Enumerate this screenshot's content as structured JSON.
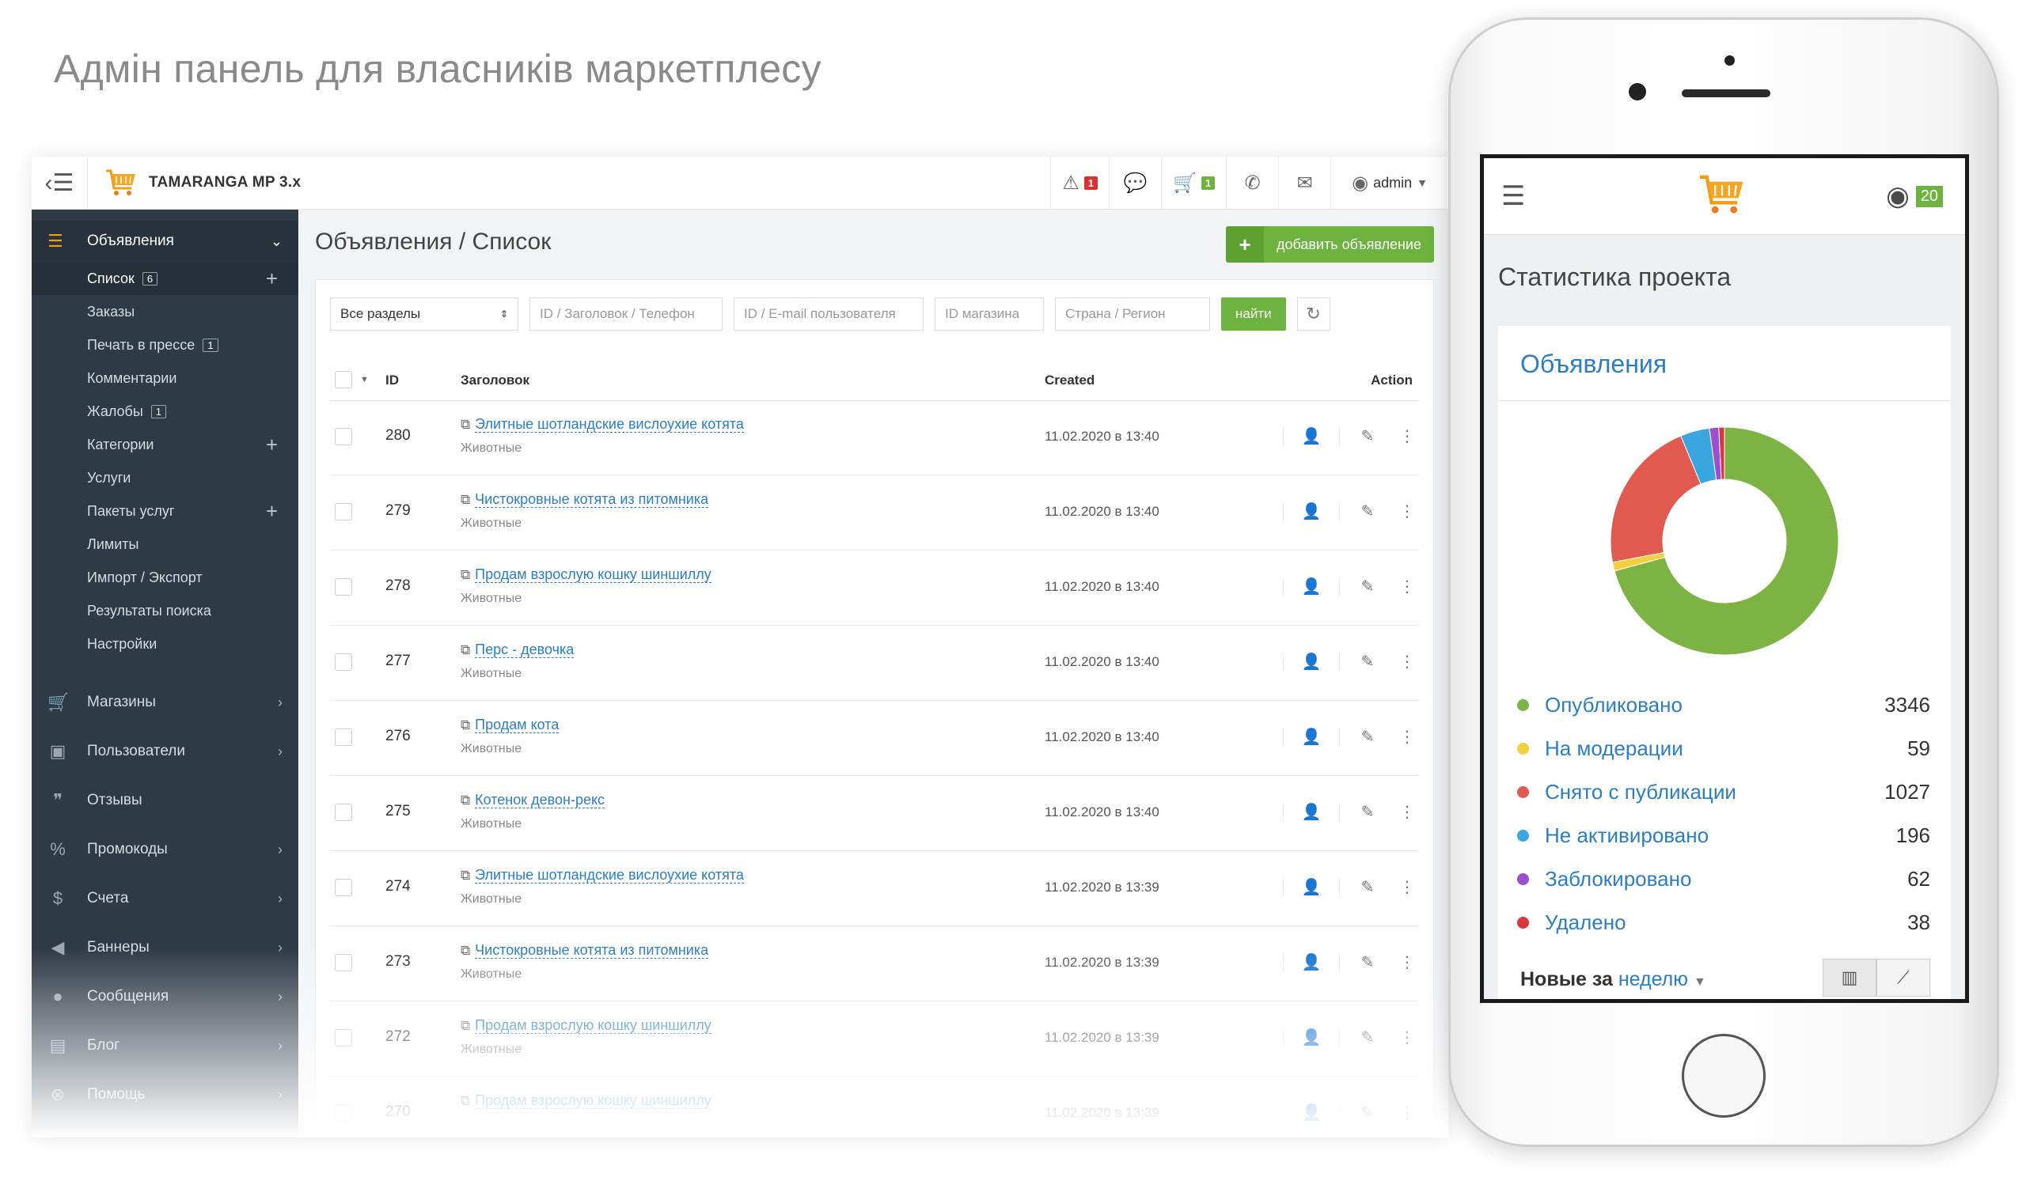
{
  "hero_title": "Адмін панель для власників маркетплесу",
  "colors": {
    "accent_green": "#6cb33f",
    "sidebar_bg": "#2e3a46",
    "link_blue": "#2a7ec1",
    "badge_red": "#d9312b"
  },
  "topbar": {
    "brand": "TAMARANGA MP 3.x",
    "alerts_count": "1",
    "cart_count": "1",
    "user": "admin",
    "icons": [
      "menu-icon",
      "warning-icon",
      "chat-icon",
      "cart-icon",
      "phone-icon",
      "envelope-icon",
      "user-icon"
    ]
  },
  "sidebar": {
    "section": "Объявления",
    "sub": [
      {
        "label": "Список",
        "count": "6",
        "plus": true,
        "active": true
      },
      {
        "label": "Заказы"
      },
      {
        "label": "Печать в прессе",
        "count": "1"
      },
      {
        "label": "Комментарии"
      },
      {
        "label": "Жалобы",
        "count": "1"
      },
      {
        "label": "Категории",
        "plus": true
      },
      {
        "label": "Услуги"
      },
      {
        "label": "Пакеты услуг",
        "plus": true
      },
      {
        "label": "Лимиты"
      },
      {
        "label": "Импорт / Экспорт"
      },
      {
        "label": "Результаты поиска"
      },
      {
        "label": "Настройки"
      }
    ],
    "main": [
      {
        "label": "Магазины",
        "icon": "cart-icon",
        "glyph": "🛒",
        "chev": true
      },
      {
        "label": "Пользователи",
        "icon": "id-card-icon",
        "glyph": "▣",
        "chev": true
      },
      {
        "label": "Отзывы",
        "icon": "quote-icon",
        "glyph": "❞",
        "chev": false
      },
      {
        "label": "Промокоды",
        "icon": "percent-icon",
        "glyph": "%",
        "chev": true
      },
      {
        "label": "Счета",
        "icon": "money-icon",
        "glyph": "$",
        "chev": true
      },
      {
        "label": "Баннеры",
        "icon": "megaphone-icon",
        "glyph": "◀",
        "chev": true
      },
      {
        "label": "Сообщения",
        "icon": "chat-icon",
        "glyph": "●",
        "chev": true
      },
      {
        "label": "Блог",
        "icon": "blog-icon",
        "glyph": "▤",
        "chev": true
      },
      {
        "label": "Помощь",
        "icon": "help-icon",
        "glyph": "⊗",
        "chev": true
      }
    ]
  },
  "content": {
    "title": "Объявления / Список",
    "add_button": "добавить объявление",
    "filters": {
      "section_select": "Все разделы",
      "title_placeholder": "ID / Заголовок / Телефон",
      "user_placeholder": "ID / E-mail пользователя",
      "shop_placeholder": "ID магазина",
      "region_placeholder": "Страна / Регион",
      "find_button": "найти"
    },
    "columns": {
      "id": "ID",
      "title": "Заголовок",
      "created": "Created",
      "action": "Action"
    },
    "rows": [
      {
        "id": "280",
        "title": "Элитные шотландские вислоухие котята",
        "category": "Животные",
        "created": "11.02.2020 в 13:40"
      },
      {
        "id": "279",
        "title": "Чистокровные котята из питомника",
        "category": "Животные",
        "created": "11.02.2020 в 13:40"
      },
      {
        "id": "278",
        "title": "Продам взрослую кошку шиншиллу",
        "category": "Животные",
        "created": "11.02.2020 в 13:40"
      },
      {
        "id": "277",
        "title": "Перс - девочка",
        "category": "Животные",
        "created": "11.02.2020 в 13:40"
      },
      {
        "id": "276",
        "title": "Продам кота",
        "category": "Животные",
        "created": "11.02.2020 в 13:40"
      },
      {
        "id": "275",
        "title": "Котенок девон-рекс",
        "category": "Животные",
        "created": "11.02.2020 в 13:40"
      },
      {
        "id": "274",
        "title": "Элитные шотландские вислоухие котята",
        "category": "Животные",
        "created": "11.02.2020 в 13:39"
      },
      {
        "id": "273",
        "title": "Чистокровные котята из питомника",
        "category": "Животные",
        "created": "11.02.2020 в 13:39"
      },
      {
        "id": "272",
        "title": "Продам взрослую кошку шиншиллу",
        "category": "Животные",
        "created": "11.02.2020 в 13:39"
      },
      {
        "id": "270",
        "title": "Продам взрослую кошку шиншиллу",
        "category": "",
        "created": "11.02.2020 в 13:39"
      }
    ]
  },
  "mobile": {
    "user_count": "20",
    "title": "Статистика проекта",
    "card_title": "Объявления",
    "legend": [
      {
        "label": "Опубликовано",
        "value": 3346,
        "color": "#7cb342"
      },
      {
        "label": "На модерации",
        "value": 59,
        "color": "#f4d03f"
      },
      {
        "label": "Снято с публикации",
        "value": 1027,
        "color": "#e05a4f"
      },
      {
        "label": "Не активировано",
        "value": 196,
        "color": "#3aa6df"
      },
      {
        "label": "Заблокировано",
        "value": 62,
        "color": "#9b4fcf"
      },
      {
        "label": "Удалено",
        "value": 38,
        "color": "#d9363e"
      }
    ],
    "footer_label": "Новые за",
    "footer_period": "неделю"
  }
}
